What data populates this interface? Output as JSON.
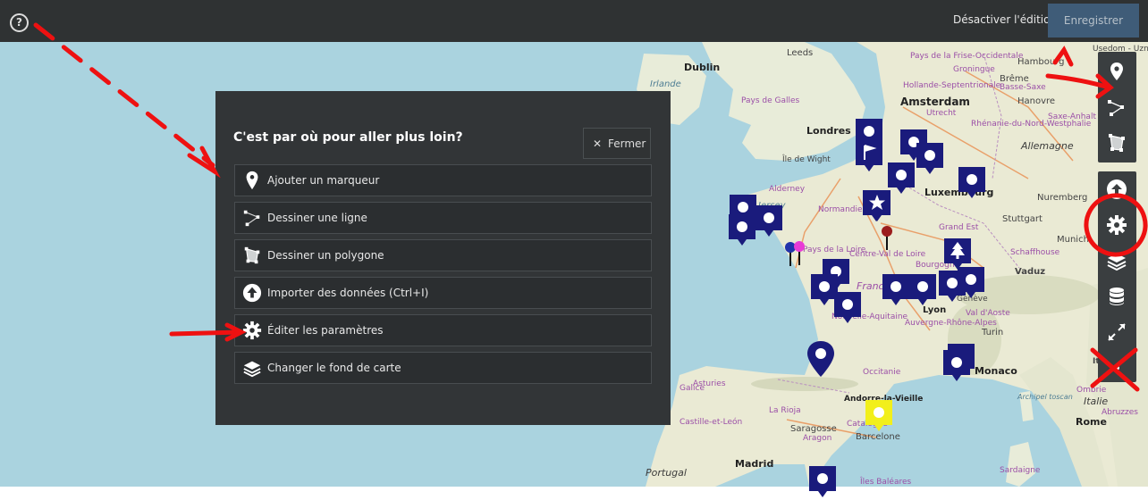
{
  "header": {
    "help_glyph": "?",
    "disable_edit_label": "Désactiver l'édition",
    "save_label": "Enregistrer"
  },
  "panel": {
    "title": "C'est par où pour aller plus loin?",
    "close_label": "Fermer",
    "actions": [
      {
        "label": "Ajouter un marqueur",
        "icon": "marker-icon"
      },
      {
        "label": "Dessiner une ligne",
        "icon": "polyline-icon"
      },
      {
        "label": "Dessiner un polygone",
        "icon": "polygon-icon"
      },
      {
        "label": "Importer des données (Ctrl+I)",
        "icon": "upload-icon"
      },
      {
        "label": "Éditer les paramètres",
        "icon": "gear-icon"
      },
      {
        "label": "Changer le fond de carte",
        "icon": "layers-icon"
      }
    ]
  },
  "map_labels": {
    "cities": [
      "Dublin",
      "Leeds",
      "Amsterdam",
      "Londres",
      "Luxembourg",
      "Nuremberg",
      "Stuttgart",
      "Hambourg",
      "Brême",
      "Hanovre",
      "Munich",
      "Vaduz",
      "Lyon",
      "Turin",
      "Monaco",
      "Madrid",
      "Barcelone",
      "Saragosse",
      "Rome"
    ],
    "regions": [
      "Irlande",
      "Pays de Galles",
      "Île de Wight",
      "Alderney",
      "Normandie",
      "Pays de la Loire",
      "Centre-Val de Loire",
      "Bourgogne",
      "Grand Est",
      "Nouvelle-Aquitaine",
      "Auvergne-Rhône-Alpes",
      "Occitanie",
      "Catalogne",
      "Aragon",
      "Castille-et-León",
      "Portugal",
      "Allemagne",
      "Italie",
      "Andorre-la-Vieille",
      "France",
      "Hollande-Septentrionale",
      "Utrecht",
      "Rhénanie-du-Nord-Westphalie",
      "Groningue",
      "Basse-Saxe",
      "Saxe-Anhalt",
      "Schaffhouse",
      "Genève",
      "Val d'Aoste",
      "Pays de la Frise-Occidentale",
      "Asturies",
      "La Rioja",
      "Archipel toscan",
      "Ombrie",
      "Abruzzes",
      "Sardaigne",
      "Îles Baléares",
      "Galice",
      "Usedom - Uznam",
      "Jersey",
      "Italie"
    ]
  },
  "colors": {
    "topbar": "#2f3233",
    "panel": "#323537",
    "save_button": "#3f5c78",
    "marker_navy": "#1a1b7c",
    "marker_yellow": "#f2ef1b",
    "annotation_red": "#ee1111",
    "sea": "#aad3df",
    "land": "#f2efe9"
  }
}
